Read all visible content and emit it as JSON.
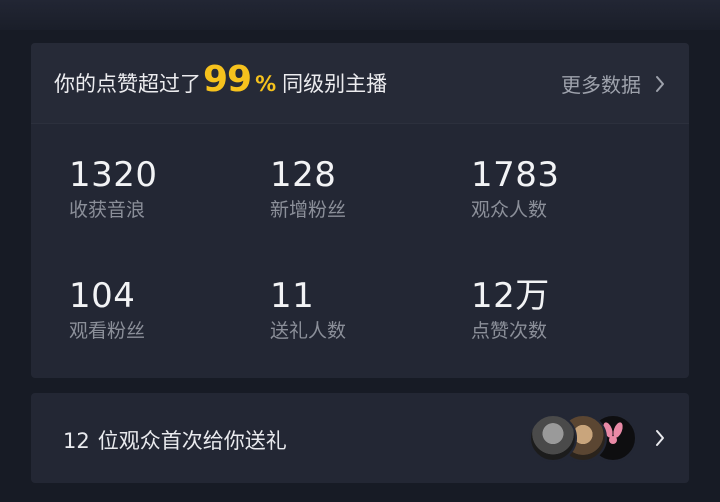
{
  "header": {
    "prefix": "你的点赞超过了",
    "percent": "99",
    "percent_sign": "%",
    "suffix": "同级别主播",
    "more_label": "更多数据"
  },
  "stats": [
    {
      "value": "1320",
      "label": "收获音浪"
    },
    {
      "value": "128",
      "label": "新增粉丝"
    },
    {
      "value": "1783",
      "label": "观众人数"
    },
    {
      "value": "104",
      "label": "观看粉丝"
    },
    {
      "value": "11",
      "label": "送礼人数"
    },
    {
      "value": "12万",
      "label": "点赞次数"
    }
  ],
  "gift": {
    "count": "12",
    "text": "位观众首次给你送礼"
  },
  "icons": [
    "chevron-right-icon",
    "avatar-1",
    "avatar-2",
    "avatar-3"
  ],
  "colors": {
    "accent": "#f6c21d",
    "background": "#171b25",
    "card": "#232734"
  }
}
